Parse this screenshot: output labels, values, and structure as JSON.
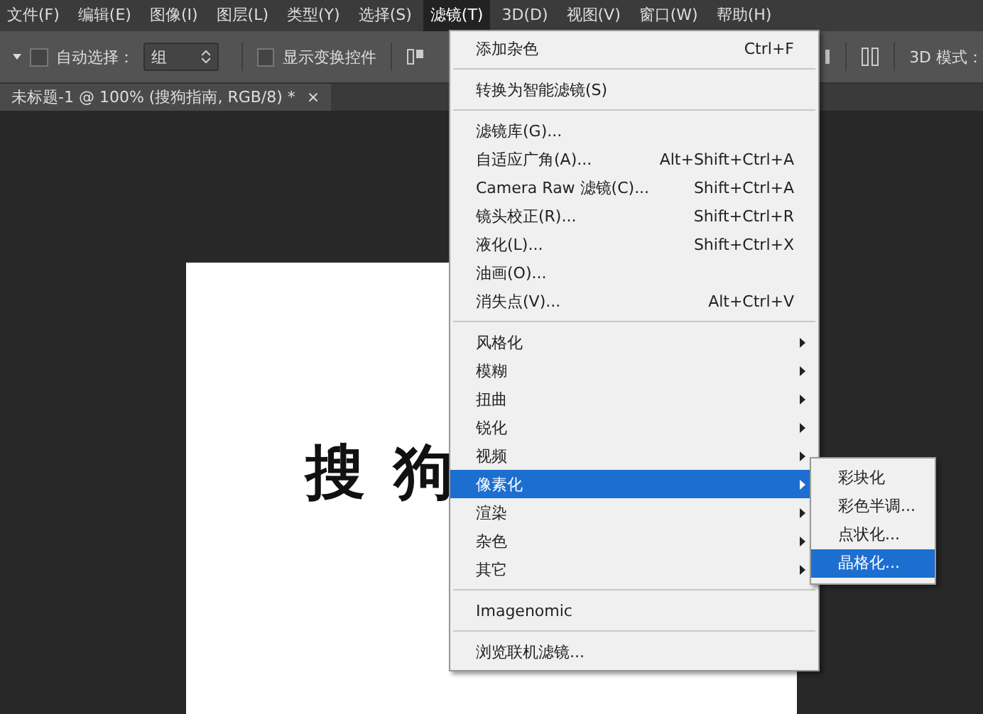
{
  "menubar": [
    {
      "label": "文件(F)",
      "selected": false
    },
    {
      "label": "编辑(E)",
      "selected": false
    },
    {
      "label": "图像(I)",
      "selected": false
    },
    {
      "label": "图层(L)",
      "selected": false
    },
    {
      "label": "类型(Y)",
      "selected": false
    },
    {
      "label": "选择(S)",
      "selected": false
    },
    {
      "label": "滤镜(T)",
      "selected": true
    },
    {
      "label": "3D(D)",
      "selected": false
    },
    {
      "label": "视图(V)",
      "selected": false
    },
    {
      "label": "窗口(W)",
      "selected": false
    },
    {
      "label": "帮助(H)",
      "selected": false
    }
  ],
  "options_bar": {
    "auto_select": {
      "label": "自动选择：",
      "checked": false
    },
    "group_select": {
      "value": "组"
    },
    "show_transform": {
      "label": "显示变换控件",
      "checked": false
    },
    "mode_label": "3D 模式："
  },
  "document_tab": {
    "title": "未标题-1 @ 100% (搜狗指南, RGB/8) *",
    "close": "×"
  },
  "canvas": {
    "text": "搜狗"
  },
  "filter_menu": {
    "items": [
      {
        "kind": "item",
        "label": "添加杂色",
        "shortcut": "Ctrl+F"
      },
      {
        "kind": "separator"
      },
      {
        "kind": "item",
        "label": "转换为智能滤镜(S)"
      },
      {
        "kind": "separator"
      },
      {
        "kind": "item",
        "label": "滤镜库(G)..."
      },
      {
        "kind": "item",
        "label": "自适应广角(A)...",
        "shortcut": "Alt+Shift+Ctrl+A"
      },
      {
        "kind": "item",
        "label": "Camera Raw 滤镜(C)...",
        "shortcut": "Shift+Ctrl+A"
      },
      {
        "kind": "item",
        "label": "镜头校正(R)...",
        "shortcut": "Shift+Ctrl+R"
      },
      {
        "kind": "item",
        "label": "液化(L)...",
        "shortcut": "Shift+Ctrl+X"
      },
      {
        "kind": "item",
        "label": "油画(O)..."
      },
      {
        "kind": "item",
        "label": "消失点(V)...",
        "shortcut": "Alt+Ctrl+V"
      },
      {
        "kind": "separator"
      },
      {
        "kind": "submenu",
        "label": "风格化",
        "selected": false
      },
      {
        "kind": "submenu",
        "label": "模糊",
        "selected": false
      },
      {
        "kind": "submenu",
        "label": "扭曲",
        "selected": false
      },
      {
        "kind": "submenu",
        "label": "锐化",
        "selected": false
      },
      {
        "kind": "submenu",
        "label": "视频",
        "selected": false
      },
      {
        "kind": "submenu",
        "label": "像素化",
        "selected": true
      },
      {
        "kind": "submenu",
        "label": "渲染",
        "selected": false
      },
      {
        "kind": "submenu",
        "label": "杂色",
        "selected": false
      },
      {
        "kind": "submenu",
        "label": "其它",
        "selected": false
      },
      {
        "kind": "separator"
      },
      {
        "kind": "item",
        "label": "Imagenomic"
      },
      {
        "kind": "separator"
      },
      {
        "kind": "item",
        "label": "浏览联机滤镜..."
      }
    ]
  },
  "submenu": {
    "items": [
      {
        "label": "彩块化",
        "selected": false
      },
      {
        "label": "彩色半调...",
        "selected": false
      },
      {
        "label": "点状化...",
        "selected": false
      },
      {
        "label": "晶格化...",
        "selected": true
      }
    ]
  }
}
